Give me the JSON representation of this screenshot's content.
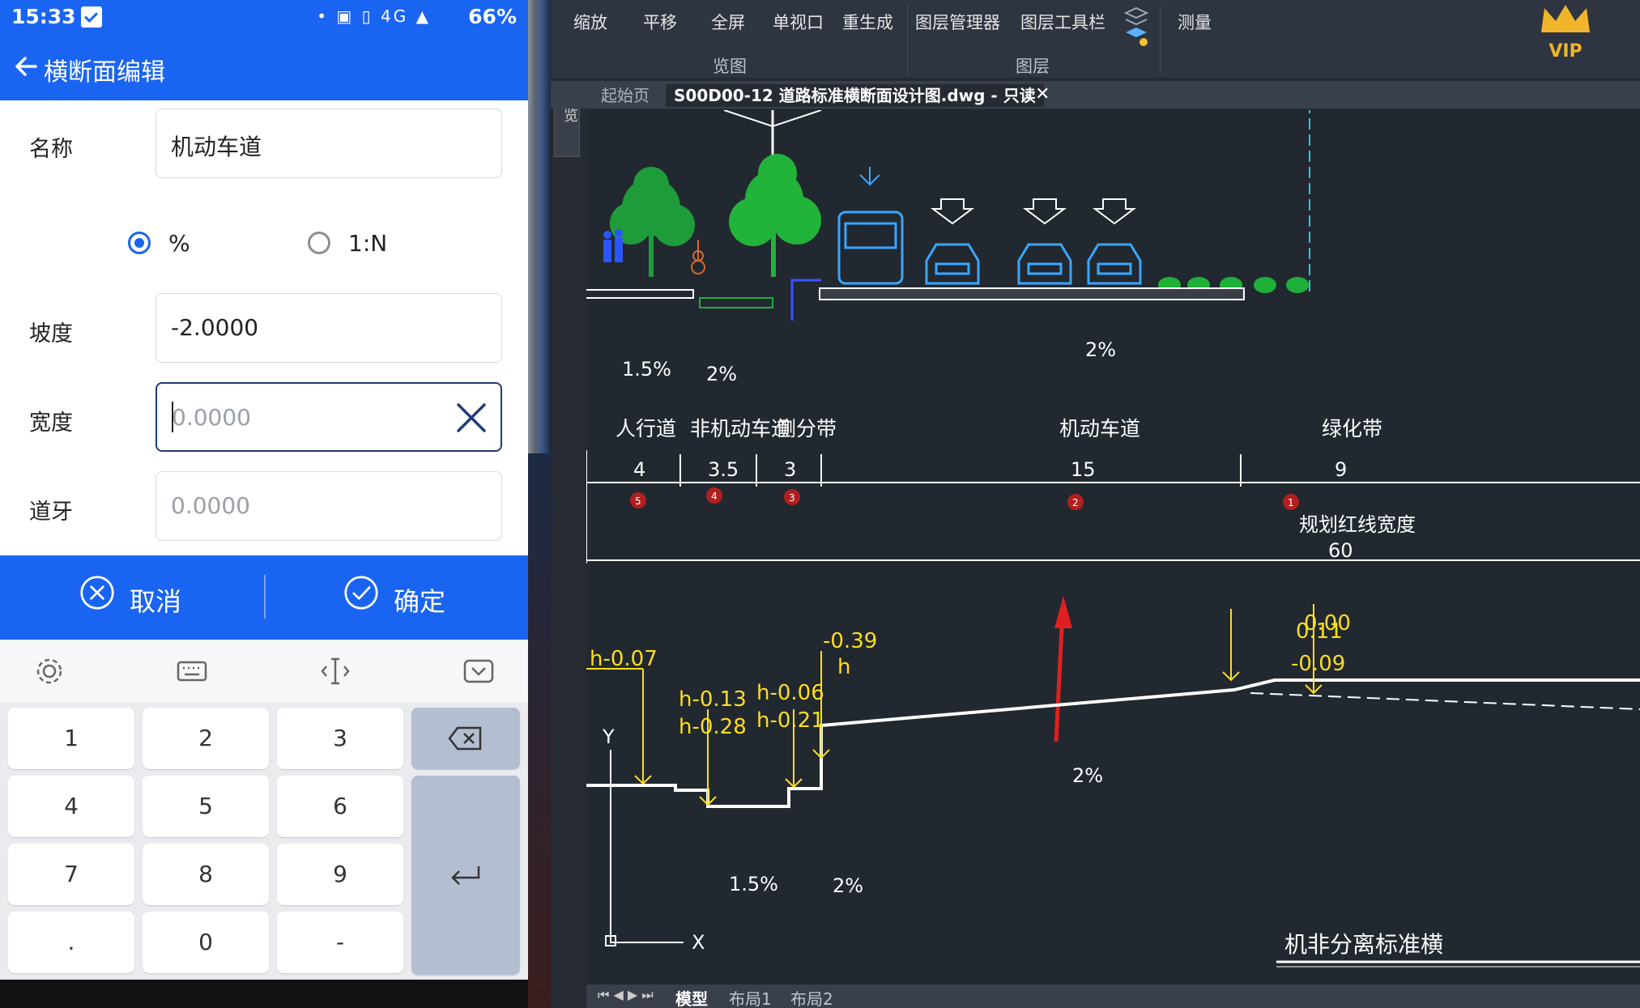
{
  "status_bar": {
    "time": "15:33",
    "signal_icons": "• ▣ ▯ 4G ▲",
    "battery": "66%"
  },
  "app_bar": {
    "title": "横断面编辑"
  },
  "form": {
    "name": {
      "label": "名称",
      "value": "机动车道"
    },
    "slope_unit": {
      "options": [
        "%",
        "1:N"
      ],
      "selected": "%"
    },
    "slope": {
      "label": "坡度",
      "value": "-2.0000"
    },
    "width": {
      "label": "宽度",
      "placeholder": "0.0000"
    },
    "curb": {
      "label": "道牙",
      "placeholder": "0.0000"
    }
  },
  "actions": {
    "cancel": "取消",
    "confirm": "确定"
  },
  "keyboard": {
    "toolbar_icons": [
      "gear-icon",
      "keyboard-icon",
      "cursor-move-icon",
      "hide-keyboard-icon"
    ],
    "keys": [
      "1",
      "2",
      "3",
      "4",
      "5",
      "6",
      "7",
      "8",
      "9",
      ".",
      "0",
      "-"
    ]
  },
  "cad": {
    "ribbon": {
      "buttons": [
        "缩放",
        "平移",
        "全屏",
        "单视口",
        "重生成",
        "图层管理器",
        "图层工具栏",
        "测量"
      ],
      "groups": [
        "览图",
        "图层"
      ],
      "vip": "VIP"
    },
    "tabs": {
      "start": "起始页",
      "document": "S00D00-12 道路标准横断面设计图.dwg - 只读"
    },
    "left_strip": "浏览",
    "bottom_tabs": [
      "模型",
      "布局1",
      "布局2"
    ],
    "drawing": {
      "slopes": [
        "1.5%",
        "2%",
        "2%",
        "2%",
        "1.5%",
        "2%"
      ],
      "lane_names": [
        "人行道",
        "非机动车道",
        "侧分带",
        "机动车道",
        "绿化带"
      ],
      "lane_widths": [
        "4",
        "3.5",
        "3",
        "15",
        "9"
      ],
      "markers": [
        "5",
        "4",
        "3",
        "2",
        "1"
      ],
      "red_line_label": "规划红线宽度",
      "red_line_width": "60",
      "elevations": [
        "h-0.07",
        "h-0.13",
        "h-0.28",
        "h-0.06",
        "h-0.21",
        "-0.39",
        "h",
        "0.11",
        "-0.09",
        "0.00"
      ],
      "axis_y": "Y",
      "axis_x": "X",
      "title_fragment": "机非分离标准横"
    }
  },
  "colors": {
    "accent": "#1a64f2",
    "cad_bg": "#212830",
    "cad_line": "#ffffff",
    "cad_dim": "#ffdd22",
    "marker": "#b21f1f",
    "arrow": "#e02020",
    "bus": "#3aa6ff",
    "tree": "#1f9c3a"
  }
}
